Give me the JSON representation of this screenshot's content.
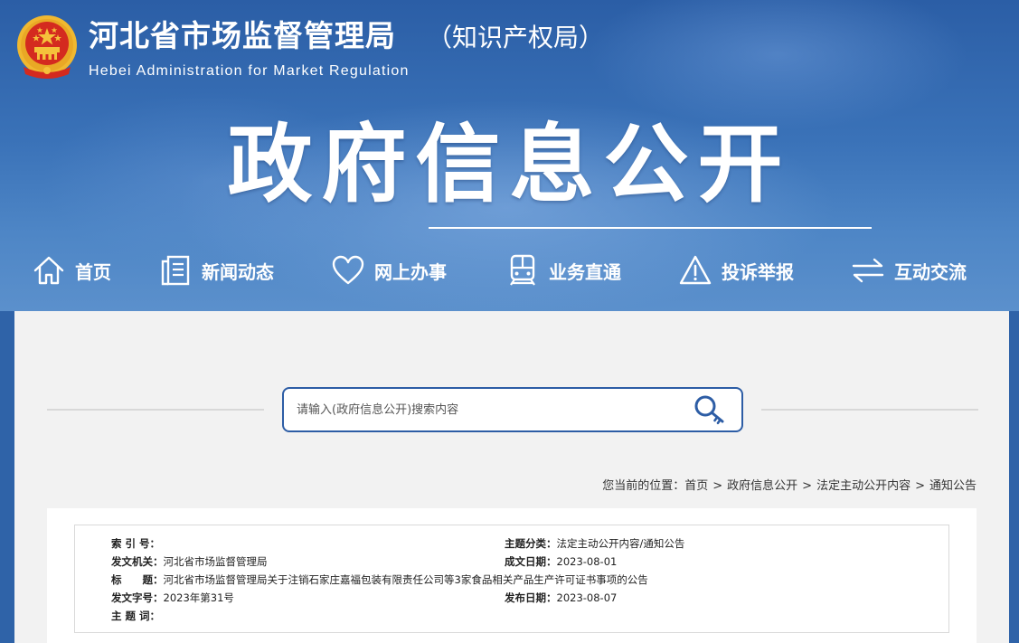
{
  "header": {
    "title": "河北省市场监督管理局",
    "title_suffix": "（知识产权局）",
    "subtitle": "Hebei Administration for Market Regulation",
    "emblem_icon": "national-emblem"
  },
  "hero": {
    "title": "政府信息公开"
  },
  "nav": {
    "items": [
      {
        "label": "首页",
        "icon": "home-icon"
      },
      {
        "label": "新闻动态",
        "icon": "document-icon"
      },
      {
        "label": "网上办事",
        "icon": "heart-icon"
      },
      {
        "label": "业务直通",
        "icon": "train-icon"
      },
      {
        "label": "投诉举报",
        "icon": "warning-icon"
      },
      {
        "label": "互动交流",
        "icon": "swap-arrows-icon"
      }
    ]
  },
  "search": {
    "placeholder": "请输入(政府信息公开)搜索内容",
    "icon": "search-key-icon"
  },
  "breadcrumb": {
    "prefix": "您当前的位置：",
    "items": [
      "首页",
      "政府信息公开",
      "法定主动公开内容",
      "通知公告"
    ],
    "separator": ">"
  },
  "meta": {
    "index_no": {
      "label": "索 引 号：",
      "value": ""
    },
    "subject_category": {
      "label": "主题分类：",
      "value": "法定主动公开内容/通知公告"
    },
    "issuer": {
      "label": "发文机关：",
      "value": "河北省市场监督管理局"
    },
    "created_date": {
      "label": "成文日期：",
      "value": "2023-08-01"
    },
    "title": {
      "label": "标　　题：",
      "value": "河北省市场监督管理局关于注销石家庄嘉福包装有限责任公司等3家食品相关产品生产许可证书事项的公告"
    },
    "doc_no": {
      "label": "发文字号：",
      "value": "2023年第31号"
    },
    "publish_date": {
      "label": "发布日期：",
      "value": "2023-08-07"
    },
    "keywords": {
      "label": "主 题 词：",
      "value": ""
    }
  },
  "colors": {
    "banner_blue": "#2f63a8",
    "accent_blue": "#2d5da5",
    "emblem_red": "#d42a1f",
    "emblem_gold": "#f5c13b",
    "content_bg": "#f2f2f2"
  }
}
